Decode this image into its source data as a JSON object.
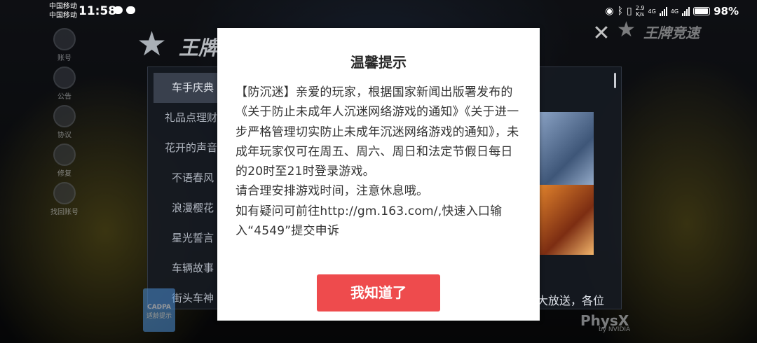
{
  "status_bar": {
    "carrier_1": "中国移动",
    "carrier_2": "中国移动",
    "time": "11:58",
    "net_speed_value": "2.9",
    "net_speed_unit": "K/s",
    "net_type_1": "4G",
    "net_type_2": "4G",
    "battery_percent": "98%"
  },
  "side_icons": [
    "账号",
    "公告",
    "协议",
    "修复",
    "找回账号"
  ],
  "background_panel": {
    "logo_text": "王牌",
    "logo_right_text": "王牌竞速",
    "menu_items": [
      "车手庆典",
      "礼品点理财",
      "花开的声音",
      "不语春风",
      "浪漫樱花",
      "星光誓言",
      "车辆故事",
      "街头车神"
    ],
    "partial_text": "大放送，各位",
    "cadpa_label": "CADPA",
    "cadpa_sub": "适龄提示",
    "physx_brand": "PhysX",
    "physx_sub": "by NVIDIA"
  },
  "dialog": {
    "title": "温馨提示",
    "paragraph_1": "【防沉迷】亲爱的玩家，根据国家新闻出版署发布的《关于防止未成年人沉迷网络游戏的通知》《关于进一步严格管理切实防止未成年沉迷网络游戏的通知》，未成年玩家仅可在周五、周六、周日和法定节假日每日的20时至21时登录游戏。",
    "paragraph_2": "请合理安排游戏时间，注意休息哦。",
    "paragraph_3": "如有疑问可前往http://gm.163.com/,快速入口输入“4549”提交申诉",
    "ok_button": "我知道了"
  },
  "colors": {
    "ok_button_bg": "#ee4b4d",
    "dialog_bg": "#ffffff",
    "panel_bg": "#161a22"
  }
}
